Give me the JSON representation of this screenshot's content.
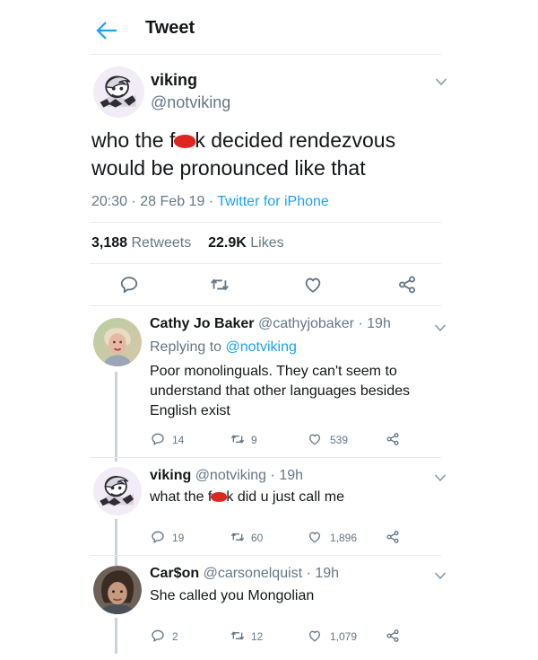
{
  "header": {
    "title": "Tweet"
  },
  "main_tweet": {
    "name": "viking",
    "handle": "@notviking",
    "text_line1_pre": "who the f",
    "text_line1_post": "k decided rendezvous",
    "text_line2": "would be pronounced like that",
    "time": "20:30",
    "date": "28 Feb 19",
    "source": "Twitter for iPhone",
    "retweet_count": "3,188",
    "retweet_label": "Retweets",
    "like_count": "22.9K",
    "like_label": "Likes"
  },
  "replies": [
    {
      "name": "Cathy Jo Baker",
      "handle": "@cathyjobaker",
      "time": "19h",
      "replying_label": "Replying to",
      "replying_handle": "@notviking",
      "text_lines": [
        "Poor monolinguals. They can't seem to",
        "understand that other languages besides",
        "English exist"
      ],
      "replies": "14",
      "retweets": "9",
      "likes": "539"
    },
    {
      "name": "viking",
      "handle": "@notviking",
      "time": "19h",
      "text_pre": "what the f",
      "text_post": "k did u just call me",
      "replies": "19",
      "retweets": "60",
      "likes": "1,896"
    },
    {
      "name": "Car$on",
      "handle": "@carsonelquist",
      "time": "19h",
      "text": "She called you Mongolian",
      "replies": "2",
      "retweets": "12",
      "likes": "1,079"
    }
  ],
  "colors": {
    "accent": "#1da1f2",
    "muted": "#657786",
    "text": "#14171a",
    "censor": "#e0241e"
  },
  "icons": [
    "back-arrow-icon",
    "chevron-down-icon",
    "reply-icon",
    "retweet-icon",
    "like-icon",
    "share-icon"
  ]
}
